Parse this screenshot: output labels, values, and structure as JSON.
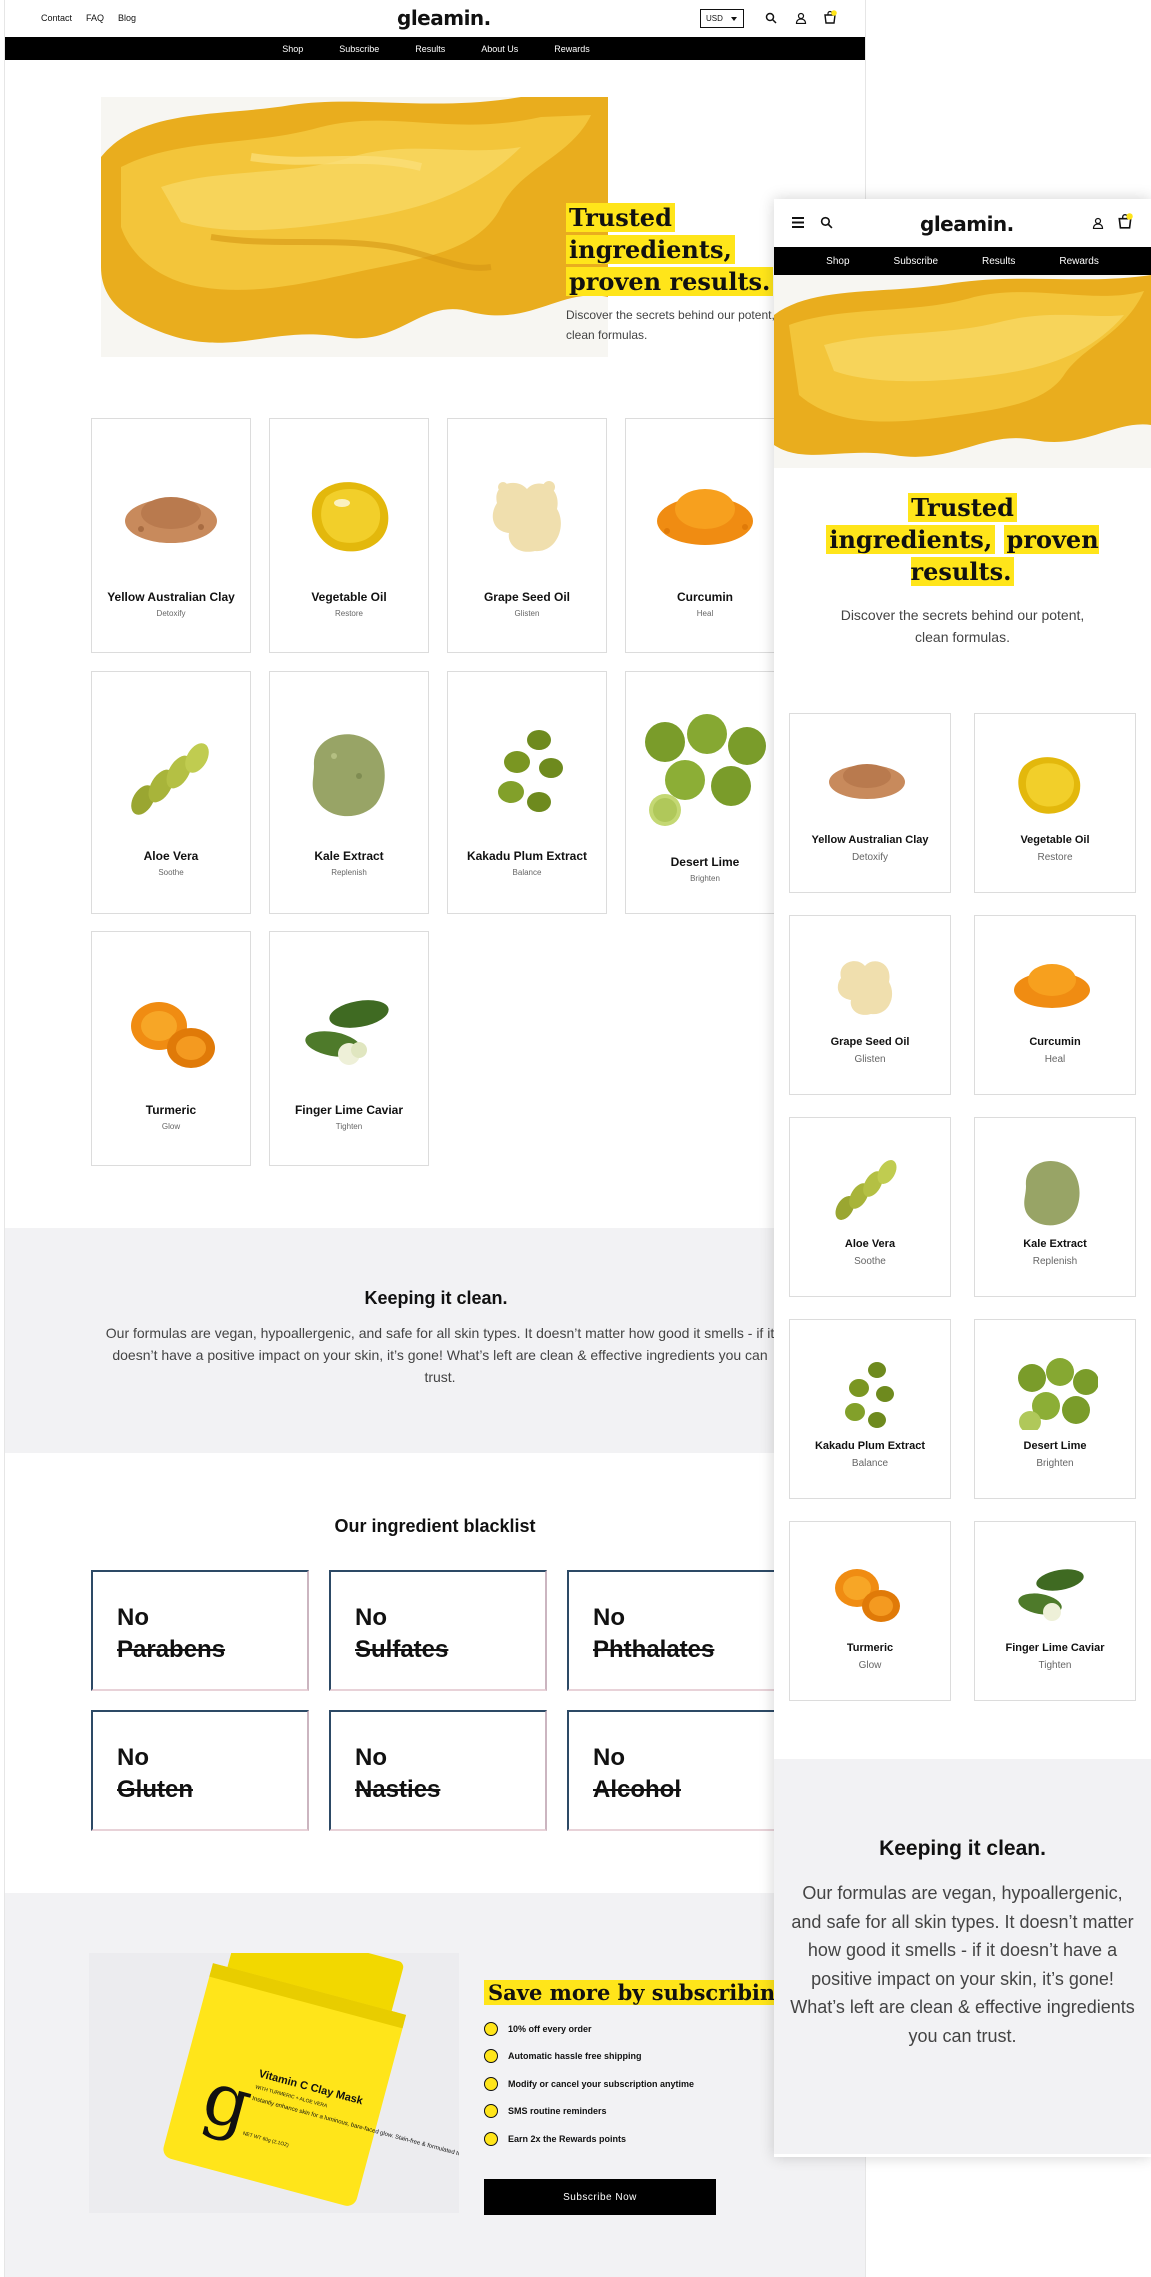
{
  "brand": {
    "logo": "gleamin.",
    "accent_color": "#ffe51a"
  },
  "desktop": {
    "top_links": [
      "Contact",
      "FAQ",
      "Blog"
    ],
    "currency": "USD",
    "cart_count": "1",
    "nav": [
      "Shop",
      "Subscribe",
      "Results",
      "About Us",
      "Rewards"
    ],
    "hero": {
      "title_lines": [
        "Trusted",
        "ingredients,",
        "proven results."
      ],
      "subtitle": "Discover the secrets behind our potent, clean formulas."
    },
    "ingredients": [
      {
        "name": "Yellow Australian Clay",
        "benefit": "Detoxify",
        "icon": "clay-powder-image"
      },
      {
        "name": "Vegetable Oil",
        "benefit": "Restore",
        "icon": "oil-drop-image"
      },
      {
        "name": "Grape Seed Oil",
        "benefit": "Glisten",
        "icon": "cream-blob-image"
      },
      {
        "name": "Curcumin",
        "benefit": "Heal",
        "icon": "orange-powder-image"
      },
      {
        "name": "Aloe Vera",
        "benefit": "Soothe",
        "icon": "aloe-slices-image"
      },
      {
        "name": "Kale Extract",
        "benefit": "Replenish",
        "icon": "green-powder-image"
      },
      {
        "name": "Kakadu Plum Extract",
        "benefit": "Balance",
        "icon": "green-plums-image"
      },
      {
        "name": "Desert Lime",
        "benefit": "Brighten",
        "icon": "limes-image"
      },
      {
        "name": "Turmeric",
        "benefit": "Glow",
        "icon": "turmeric-image"
      },
      {
        "name": "Finger Lime Caviar",
        "benefit": "Tighten",
        "icon": "finger-lime-image"
      }
    ],
    "clean": {
      "title": "Keeping it clean.",
      "text": "Our formulas are vegan, hypoallergenic, and safe for all skin types. It doesn’t matter how good it smells - if it doesn’t have a positive impact on your skin, it’s gone! What’s left are clean & effective ingredients you can trust."
    },
    "blacklist": {
      "title": "Our ingredient blacklist",
      "prefix": "No",
      "items": [
        "Parabens",
        "Sulfates",
        "Phthalates",
        "Gluten",
        "Nasties",
        "Alcohol"
      ]
    },
    "subscribe": {
      "title": "Save more by subscribing.",
      "product_name": "Vitamin C Clay Mask",
      "product_sub": "WITH TURMERIC + ALOE VERA",
      "product_desc": "Instantly enhance skin for a luminous, bare-faced glow. Stain-free & formulated to work with all skin types.",
      "product_size": "NET WT 60g (2.1OZ)",
      "perks": [
        "10% off every order",
        "Automatic hassle free shipping",
        "Modify or cancel your subscription anytime",
        "SMS routine reminders",
        "Earn 2x the Rewards points"
      ],
      "button": "Subscribe Now"
    }
  },
  "mobile": {
    "nav": [
      "Shop",
      "Subscribe",
      "Results",
      "Rewards"
    ],
    "cart_count": "1"
  }
}
